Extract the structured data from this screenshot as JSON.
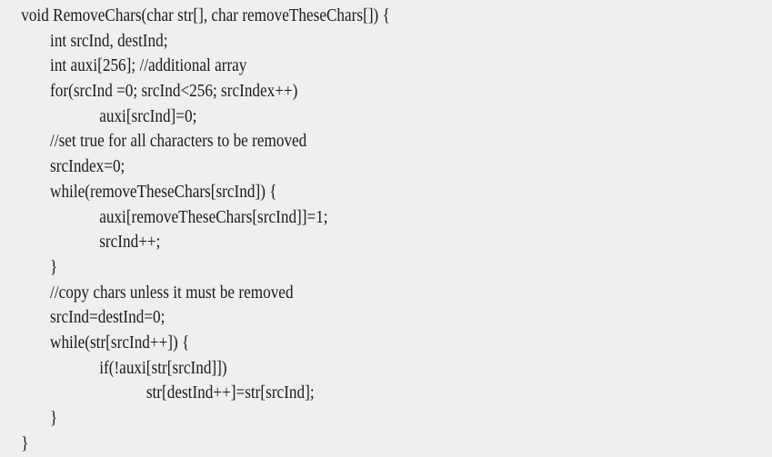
{
  "code": {
    "lines": [
      {
        "text": "void RemoveChars(char str[], char removeTheseChars[]) {",
        "indent": 0
      },
      {
        "text": "int srcInd, destInd;",
        "indent": 1
      },
      {
        "text": "int auxi[256]; //additional array",
        "indent": 1
      },
      {
        "text": "for(srcInd =0; srcInd<256; srcIndex++)",
        "indent": 1
      },
      {
        "text": "auxi[srcInd]=0;",
        "indent": 2
      },
      {
        "text": "//set true for all characters to be removed",
        "indent": 1
      },
      {
        "text": "srcIndex=0;",
        "indent": 1
      },
      {
        "text": "while(removeTheseChars[srcInd]) {",
        "indent": 1
      },
      {
        "text": "auxi[removeTheseChars[srcInd]]=1;",
        "indent": 2
      },
      {
        "text": "srcInd++;",
        "indent": 2
      },
      {
        "text": "}",
        "indent": 1
      },
      {
        "text": "//copy chars unless it must be removed",
        "indent": 1
      },
      {
        "text": "srcInd=destInd=0;",
        "indent": 1
      },
      {
        "text": "while(str[srcInd++]) {",
        "indent": 1
      },
      {
        "text": "if(!auxi[str[srcInd]])",
        "indent": 2
      },
      {
        "text": "str[destInd++]=str[srcInd];",
        "indent": 3
      },
      {
        "text": "}",
        "indent": 1
      },
      {
        "text": "}",
        "indent": 0
      }
    ]
  }
}
